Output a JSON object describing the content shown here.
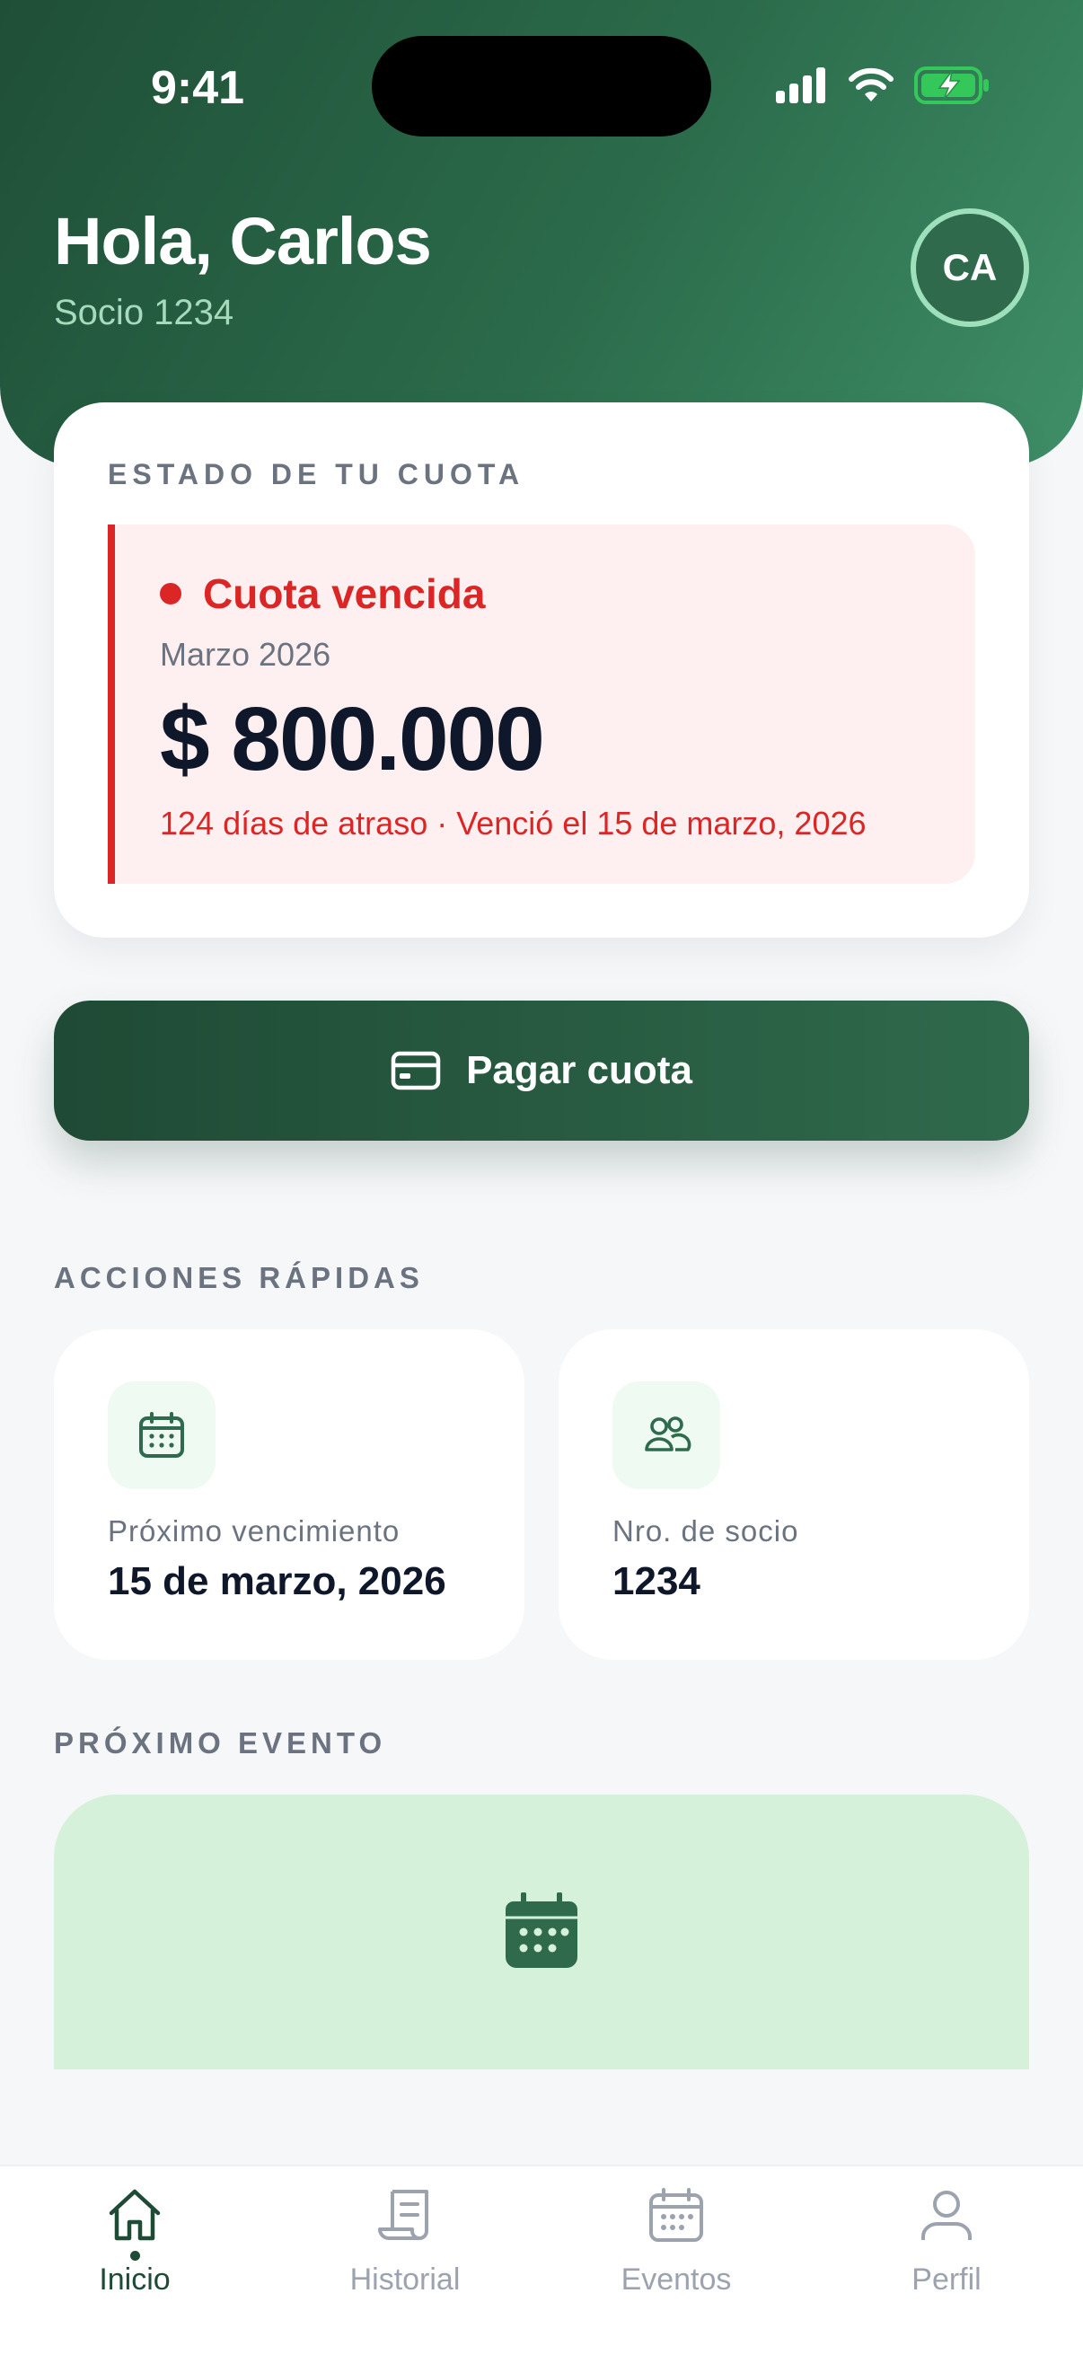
{
  "status_bar": {
    "time": "9:41"
  },
  "header": {
    "greeting": "Hola, Carlos",
    "member_label": "Socio 1234",
    "avatar_initials": "CA"
  },
  "fee_status": {
    "section_label": "ESTADO DE TU CUOTA",
    "state": "Cuota vencida",
    "month": "Marzo 2026",
    "amount": "$ 800.000",
    "detail": "124 días de atraso · Venció el 15 de marzo, 2026"
  },
  "pay_button": {
    "label": "Pagar cuota"
  },
  "quick_actions": {
    "title": "ACCIONES RÁPIDAS",
    "items": [
      {
        "label": "Próximo vencimiento",
        "value": "15 de marzo, 2026",
        "icon": "calendar-icon"
      },
      {
        "label": "Nro. de socio",
        "value": "1234",
        "icon": "users-icon"
      }
    ]
  },
  "next_event": {
    "title": "PRÓXIMO EVENTO",
    "icon": "calendar-icon"
  },
  "bottom_nav": {
    "items": [
      {
        "label": "Inicio",
        "icon": "home-icon",
        "active": true
      },
      {
        "label": "Historial",
        "icon": "receipt-icon",
        "active": false
      },
      {
        "label": "Eventos",
        "icon": "calendar-icon",
        "active": false
      },
      {
        "label": "Perfil",
        "icon": "user-icon",
        "active": false
      }
    ]
  },
  "colors": {
    "brand_dark": "#1f4a35",
    "brand": "#2f6a4c",
    "danger": "#dc2626",
    "danger_bg": "#fef0f0",
    "event_bg": "#d6f1da"
  }
}
